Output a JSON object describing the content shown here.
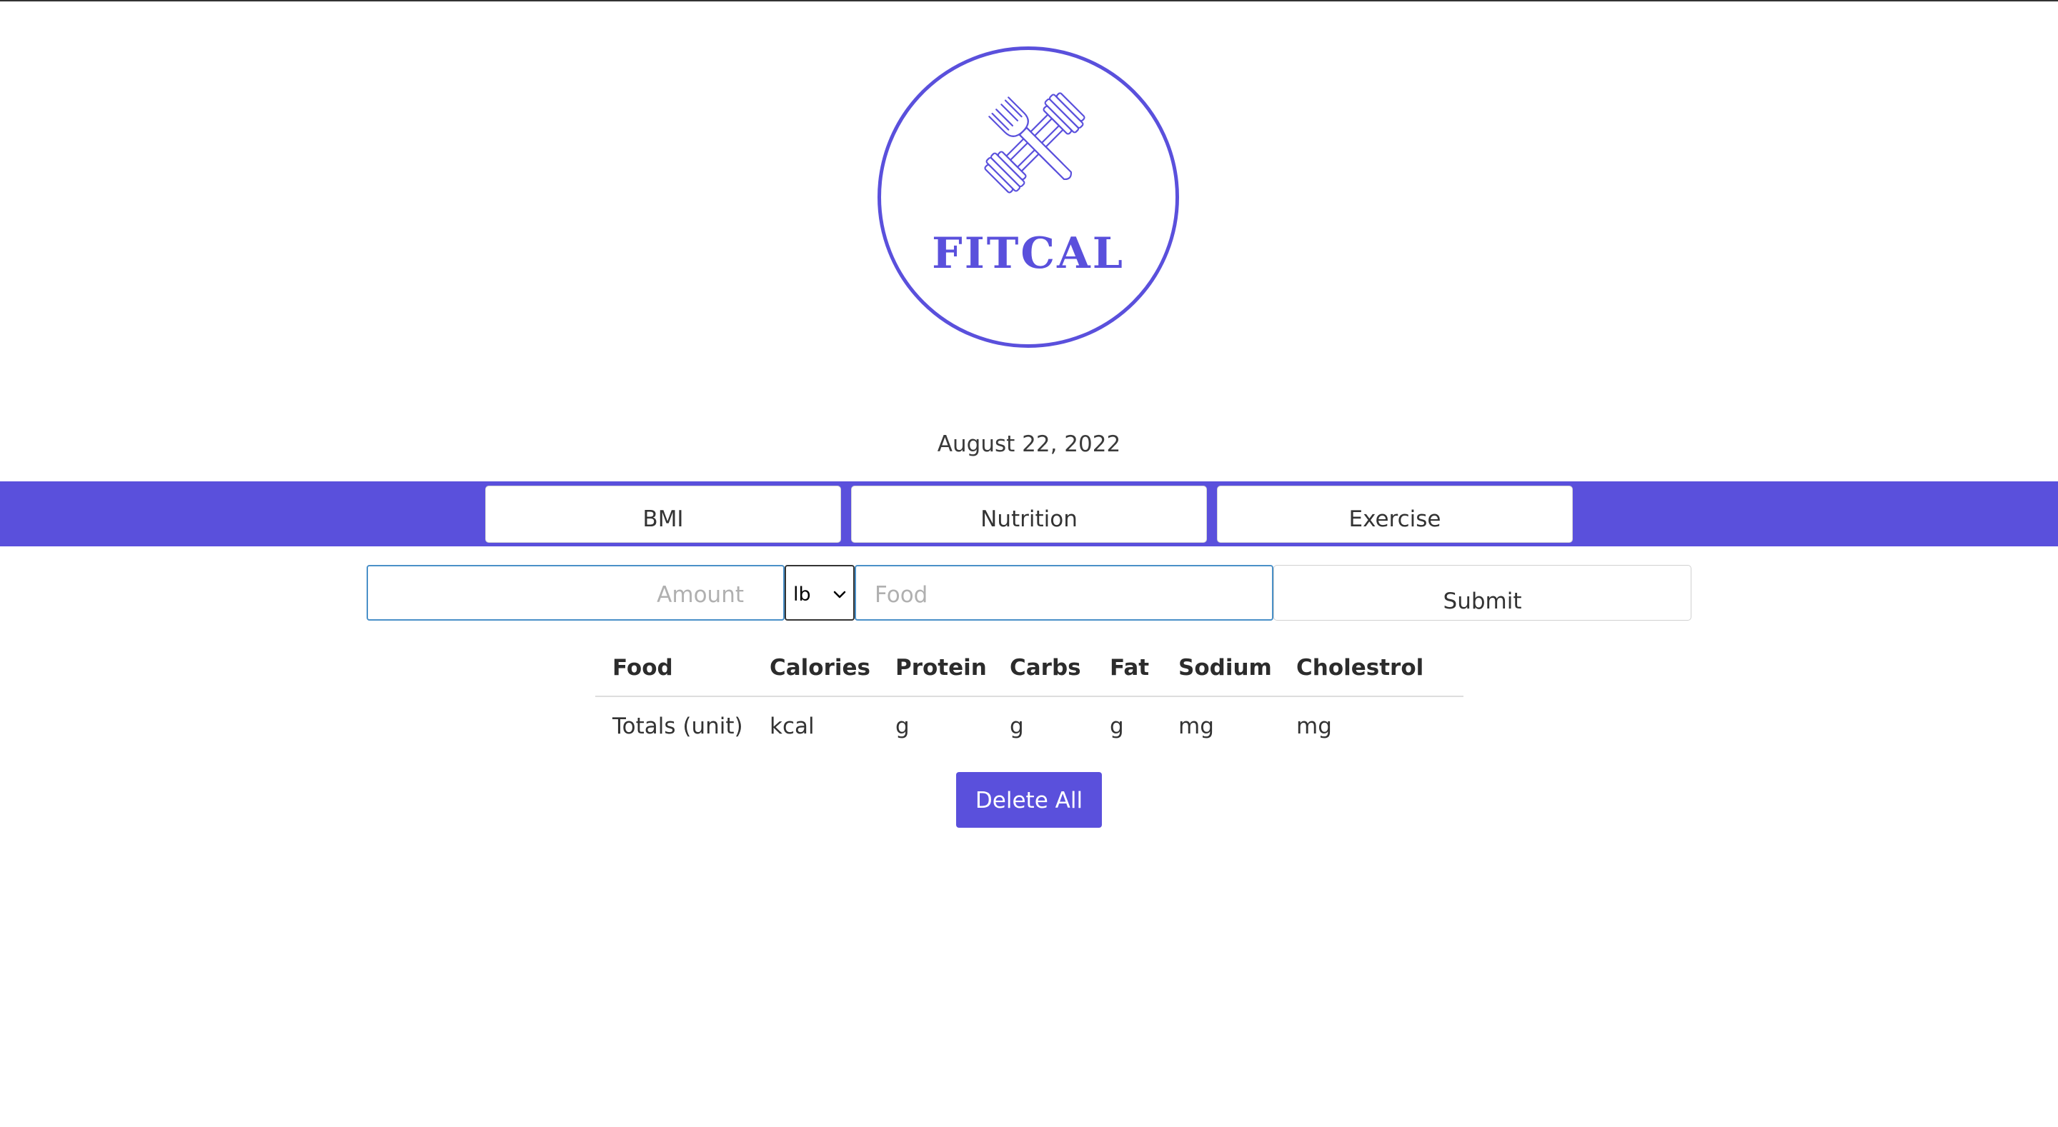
{
  "logo": {
    "icon": "fork-dumbbell-icon",
    "text": "FITCAL",
    "color": "#5a50dc"
  },
  "date": "August 22, 2022",
  "nav": {
    "background": "#5a50dc",
    "tabs": [
      {
        "label": "BMI"
      },
      {
        "label": "Nutrition"
      },
      {
        "label": "Exercise"
      }
    ]
  },
  "form": {
    "amount_placeholder": "Amount",
    "unit_selected": "lb",
    "food_placeholder": "Food",
    "submit_label": "Submit"
  },
  "table": {
    "headers": [
      "Food",
      "Calories",
      "Protein",
      "Carbs",
      "Fat",
      "Sodium",
      "Cholestrol"
    ],
    "totals_row": [
      "Totals (unit)",
      "kcal",
      "g",
      "g",
      "g",
      "mg",
      "mg"
    ]
  },
  "delete_all_label": "Delete All"
}
